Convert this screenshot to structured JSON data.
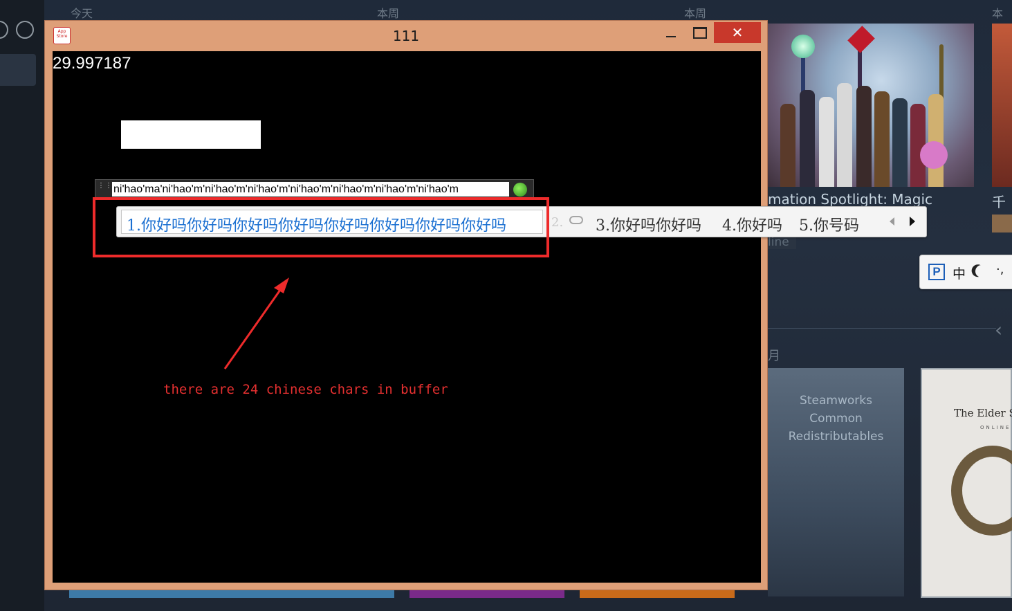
{
  "steam": {
    "dates": [
      "今天",
      "本周",
      "本周",
      "本周"
    ],
    "spotlight_title": "mation Spotlight: Magic",
    "spotlight_partial": "千",
    "online_partial": "line",
    "month_label": "月",
    "card_text_line1": "Steamworks",
    "card_text_line2": "Common",
    "card_text_line3": "Redistributables",
    "eso_title": "The Elder S",
    "eso_sub": "ONLINE"
  },
  "window": {
    "title": "111",
    "icon_label": "App Store",
    "close_label": "✕"
  },
  "app": {
    "fps_value": "29.997187"
  },
  "ime": {
    "composition": "ni'hao'ma'ni'hao'm'ni'hao'm'ni'hao'm'ni'hao'm'ni'hao'm'ni'hao'm'ni'hao'm",
    "candidates": [
      {
        "label": "1.你好吗你好吗你好吗你好吗你好吗你好吗你好吗你好吗"
      },
      {
        "label": "2."
      },
      {
        "label": "3.你好吗你好吗"
      },
      {
        "label": "4.你好吗"
      },
      {
        "label": "5.你号码"
      }
    ],
    "toolbar_mode": "中",
    "toolbar_punct": "·,"
  },
  "annotation": {
    "text": "there are 24 chinese chars in buffer",
    "color": "#ee2b2b"
  }
}
